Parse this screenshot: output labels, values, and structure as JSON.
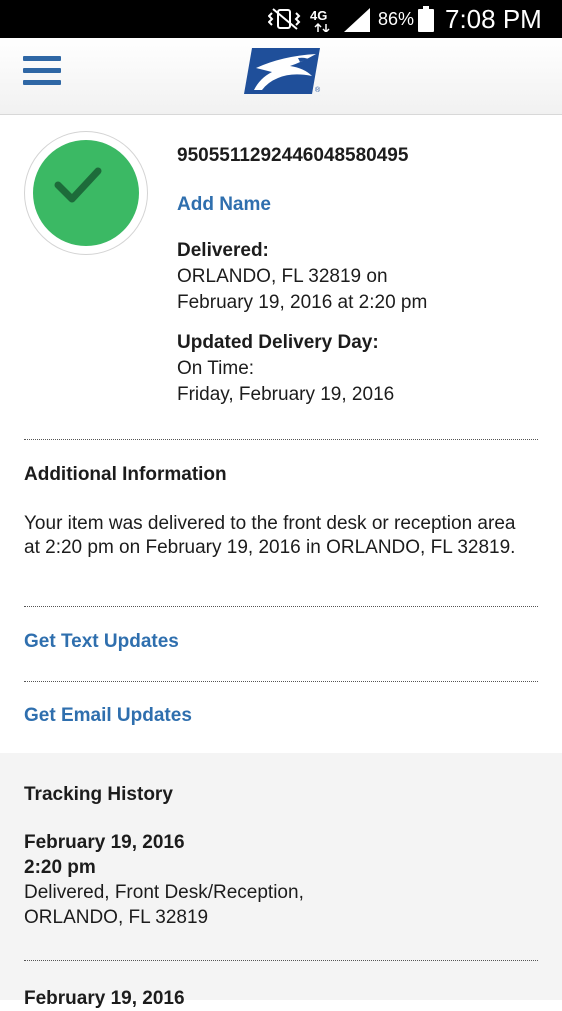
{
  "status_bar": {
    "network": "4G",
    "battery": "86%",
    "time": "7:08 PM",
    "icons": [
      "vibrate-mute-icon",
      "network-4g-lte-icon",
      "signal-icon",
      "battery-icon"
    ]
  },
  "header": {
    "menu_icon": "hamburger-menu-icon",
    "logo_icon": "usps-eagle-logo-icon"
  },
  "package": {
    "status_icon": "check-circle-icon",
    "tracking_number": "9505511292446048580495",
    "add_name_label": "Add Name",
    "delivered_heading": "Delivered:",
    "delivered_location": "ORLANDO, FL 32819 on",
    "delivered_datetime": "February 19, 2016 at 2:20 pm",
    "updated_heading": "Updated Delivery Day:",
    "updated_status": "On Time:",
    "updated_date": "Friday, February 19, 2016"
  },
  "additional": {
    "title": "Additional Information",
    "text": "Your item was delivered to the front desk or reception area at 2:20 pm on February 19, 2016 in ORLANDO, FL 32819."
  },
  "actions": {
    "text_updates": "Get Text Updates",
    "email_updates": "Get Email Updates"
  },
  "history": {
    "title": "Tracking History",
    "events": [
      {
        "date": "February 19, 2016",
        "time": "2:20 pm",
        "status": "Delivered, Front Desk/Reception,",
        "location": "ORLANDO, FL 32819"
      },
      {
        "date": "February 19, 2016"
      }
    ]
  },
  "colors": {
    "link_blue": "#2f6fae",
    "success_green": "#3bb964",
    "usps_blue": "#1f4f9a"
  }
}
